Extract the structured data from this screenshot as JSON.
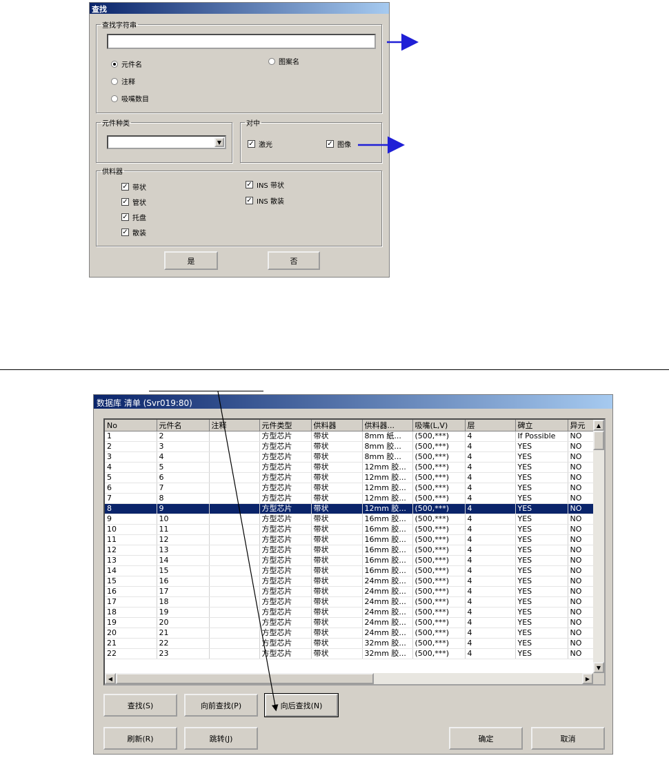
{
  "find_dialog": {
    "title": "查找",
    "search_group_label": "查找字符串",
    "search_value": "",
    "radios": [
      {
        "label": "元件名",
        "checked": true
      },
      {
        "label": "图案名",
        "checked": false
      },
      {
        "label": "注释",
        "checked": false
      },
      {
        "label": "吸嘴数目",
        "checked": false
      }
    ],
    "type_group_label": "元件种类",
    "type_value": "",
    "align_group_label": "对中",
    "align_checks": [
      {
        "label": "激光",
        "checked": true
      },
      {
        "label": "图像",
        "checked": true
      }
    ],
    "feeder_group_label": "供料器",
    "feeder_checks": [
      {
        "label": "带状",
        "checked": true
      },
      {
        "label": "管状",
        "checked": true
      },
      {
        "label": "托盘",
        "checked": true
      },
      {
        "label": "散装",
        "checked": true
      },
      {
        "label": "INS 带状",
        "checked": true
      },
      {
        "label": "INS 散装",
        "checked": true
      }
    ],
    "ok_label": "是",
    "cancel_label": "否"
  },
  "list_dialog": {
    "title": "数据库 清单 (Svr019:80)",
    "columns": [
      "No",
      "元件名",
      "注释",
      "元件类型",
      "供料器",
      "供料器...",
      "吸嘴(L,V)",
      "层",
      "碑立",
      "异元"
    ],
    "rows": [
      [
        "1",
        "2",
        "",
        "方型芯片",
        "带状",
        "8mm 紙...",
        "(500,***)",
        "4",
        "If Possible",
        "NO"
      ],
      [
        "2",
        "3",
        "",
        "方型芯片",
        "带状",
        "8mm 胶...",
        "(500,***)",
        "4",
        "YES",
        "NO"
      ],
      [
        "3",
        "4",
        "",
        "方型芯片",
        "带状",
        "8mm 胶...",
        "(500,***)",
        "4",
        "YES",
        "NO"
      ],
      [
        "4",
        "5",
        "",
        "方型芯片",
        "带状",
        "12mm 胶...",
        "(500,***)",
        "4",
        "YES",
        "NO"
      ],
      [
        "5",
        "6",
        "",
        "方型芯片",
        "带状",
        "12mm 胶...",
        "(500,***)",
        "4",
        "YES",
        "NO"
      ],
      [
        "6",
        "7",
        "",
        "方型芯片",
        "带状",
        "12mm 胶...",
        "(500,***)",
        "4",
        "YES",
        "NO"
      ],
      [
        "7",
        "8",
        "",
        "方型芯片",
        "带状",
        "12mm 胶...",
        "(500,***)",
        "4",
        "YES",
        "NO"
      ],
      [
        "8",
        "9",
        "",
        "方型芯片",
        "带状",
        "12mm 胶...",
        "(500,***)",
        "4",
        "YES",
        "NO"
      ],
      [
        "9",
        "10",
        "",
        "方型芯片",
        "带状",
        "16mm 胶...",
        "(500,***)",
        "4",
        "YES",
        "NO"
      ],
      [
        "10",
        "11",
        "",
        "方型芯片",
        "带状",
        "16mm 胶...",
        "(500,***)",
        "4",
        "YES",
        "NO"
      ],
      [
        "11",
        "12",
        "",
        "方型芯片",
        "带状",
        "16mm 胶...",
        "(500,***)",
        "4",
        "YES",
        "NO"
      ],
      [
        "12",
        "13",
        "",
        "方型芯片",
        "带状",
        "16mm 胶...",
        "(500,***)",
        "4",
        "YES",
        "NO"
      ],
      [
        "13",
        "14",
        "",
        "方型芯片",
        "带状",
        "16mm 胶...",
        "(500,***)",
        "4",
        "YES",
        "NO"
      ],
      [
        "14",
        "15",
        "",
        "方型芯片",
        "带状",
        "16mm 胶...",
        "(500,***)",
        "4",
        "YES",
        "NO"
      ],
      [
        "15",
        "16",
        "",
        "方型芯片",
        "带状",
        "24mm 胶...",
        "(500,***)",
        "4",
        "YES",
        "NO"
      ],
      [
        "16",
        "17",
        "",
        "方型芯片",
        "带状",
        "24mm 胶...",
        "(500,***)",
        "4",
        "YES",
        "NO"
      ],
      [
        "17",
        "18",
        "",
        "方型芯片",
        "带状",
        "24mm 胶...",
        "(500,***)",
        "4",
        "YES",
        "NO"
      ],
      [
        "18",
        "19",
        "",
        "方型芯片",
        "带状",
        "24mm 胶...",
        "(500,***)",
        "4",
        "YES",
        "NO"
      ],
      [
        "19",
        "20",
        "",
        "方型芯片",
        "带状",
        "24mm 胶...",
        "(500,***)",
        "4",
        "YES",
        "NO"
      ],
      [
        "20",
        "21",
        "",
        "方型芯片",
        "带状",
        "24mm 胶...",
        "(500,***)",
        "4",
        "YES",
        "NO"
      ],
      [
        "21",
        "22",
        "",
        "方型芯片",
        "带状",
        "32mm 胶...",
        "(500,***)",
        "4",
        "YES",
        "NO"
      ],
      [
        "22",
        "23",
        "",
        "方型芯片",
        "带状",
        "32mm 胶...",
        "(500,***)",
        "4",
        "YES",
        "NO"
      ]
    ],
    "selected_row": 7,
    "buttons": {
      "find": "查找(S)",
      "find_prev": "向前查找(P)",
      "find_next": "向后查找(N)",
      "refresh": "刷新(R)",
      "jump": "跳转(J)",
      "ok": "确定",
      "cancel": "取消"
    }
  },
  "colors": {
    "dialog_face": "#d4d0c8",
    "title_active": "#0a246a",
    "selection": "#0a246a",
    "annotation_arrow": "#1f1fd6"
  }
}
